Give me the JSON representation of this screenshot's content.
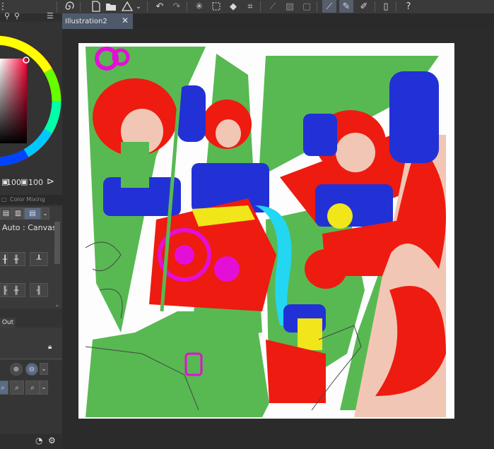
{
  "toolbar": {
    "icons": [
      "spiral-icon",
      "new-file-icon",
      "open-folder-icon",
      "warning-icon",
      "chevron-down-icon",
      "undo-icon",
      "redo-icon",
      "loading-icon",
      "transform-icon",
      "fill-icon",
      "crop-icon",
      "ruler-off-icon",
      "layer-mask-icon",
      "border-icon",
      "snap-icon",
      "pen-stroke-icon",
      "edit-icon",
      "phone-icon",
      "help-icon"
    ]
  },
  "color": {
    "main_value": "100",
    "sub_value": "100"
  },
  "tabs": {
    "color_mixing": "Color Mixing"
  },
  "tool_property": {
    "reference_label": "Auto : Canvas"
  },
  "layer": {
    "tab_label": "Out"
  },
  "document": {
    "tab_title": "Illustration2",
    "close_glyph": "✕"
  },
  "colors": {
    "accent_tab": "#4e5a6b",
    "panel_bg": "#333333",
    "toolbar_bg": "#3a3a3a",
    "canvas_bg": "#fdfdfd",
    "art_green": "#58b952",
    "art_red": "#ee1b10",
    "art_blue": "#2231d6",
    "art_magenta": "#e40fd6",
    "art_yellow": "#f0e61a",
    "art_cyan": "#23d7f2"
  }
}
